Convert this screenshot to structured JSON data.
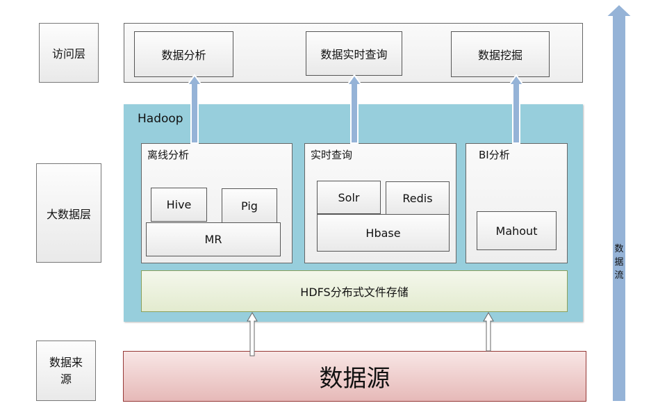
{
  "layers": {
    "access": "访问层",
    "bigdata": "大数据层",
    "source_line1": "数据来",
    "source_line2": "源"
  },
  "access_layer": {
    "items": [
      "数据分析",
      "数据实时查询",
      "数据挖掘"
    ]
  },
  "hadoop": {
    "title": "Hadoop",
    "offline": {
      "title": "离线分析",
      "hive": "Hive",
      "pig": "Pig",
      "mr": "MR"
    },
    "realtime": {
      "title": "实时查询",
      "solr": "Solr",
      "redis": "Redis",
      "hbase": "Hbase"
    },
    "bi": {
      "title": "BI分析",
      "mahout": "Mahout"
    },
    "hdfs": "HDFS分布式文件存储"
  },
  "data_source": "数据源",
  "data_flow": {
    "label": [
      "数",
      "据",
      "流"
    ]
  },
  "colors": {
    "hadoop_bg": "#97CEDC",
    "hdfs_bg": "#EBF1DE",
    "source_bg": "#F2DCDB",
    "arrow": "#95B3D7"
  }
}
